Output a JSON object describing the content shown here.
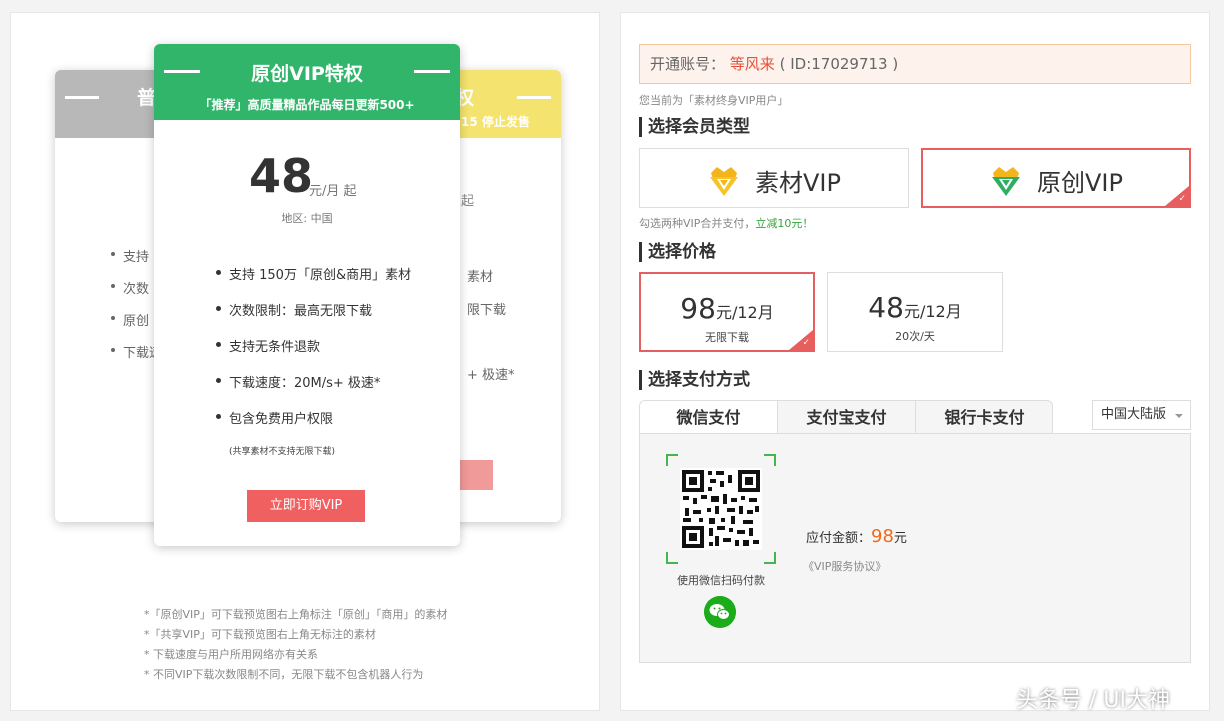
{
  "left": {
    "normal_card": {
      "title": "普",
      "items": [
        "支持",
        "次数",
        "原创",
        "下载速"
      ]
    },
    "shared_card": {
      "title": "权",
      "subtitle": "15 停止发售",
      "per": "起",
      "items": [
        "素材",
        "限下载",
        "+ 极速*"
      ]
    },
    "vip_card": {
      "title": "原创VIP特权",
      "subtitle": "「推荐」高质量精品作品每日更新500+",
      "price": "48",
      "price_unit": "元/月 起",
      "region": "地区: 中国",
      "features": [
        "支持 150万「原创&商用」素材",
        "次数限制：最高无限下载",
        "支持无条件退款",
        "下载速度：20M/s+ 极速*",
        "包含免费用户权限"
      ],
      "feature_note": "(共享素材不支持无限下载)",
      "buy_label": "立即订购VIP"
    },
    "notes": [
      "*「原创VIP」可下载预览图右上角标注「原创」「商用」的素材",
      "*「共享VIP」可下载预览图右上角无标注的素材",
      "* 下载速度与用户所用网络亦有关系",
      "* 不同VIP下载次数限制不同，无限下载不包含机器人行为"
    ]
  },
  "right": {
    "account_label": "开通账号：",
    "account_name": "等风来",
    "account_id": "( ID:17029713 )",
    "current_status": "您当前为「素材终身VIP用户」",
    "section_type": "选择会员类型",
    "type_material": "素材VIP",
    "type_original": "原创VIP",
    "combine_tip": "勾选两种VIP合并支付，",
    "combine_discount": "立减10元！",
    "section_price": "选择价格",
    "price_options": [
      {
        "amount": "98",
        "unit": "元/12月",
        "desc": "无限下载"
      },
      {
        "amount": "48",
        "unit": "元/12月",
        "desc": "20次/天"
      }
    ],
    "section_pay": "选择支付方式",
    "tabs": [
      "微信支付",
      "支付宝支付",
      "银行卡支付"
    ],
    "region_select": "中国大陆版",
    "scan_tip": "使用微信扫码付款",
    "due_label": "应付金额：",
    "due_amount": "98",
    "due_unit": "元",
    "agreement": "《VIP服务协议》"
  },
  "watermark": "头条号 / UI大神",
  "colors": {
    "vip_green": "#31b56a",
    "shared_yellow": "#f4e36f",
    "normal_gray": "#b8b8b8",
    "accent_red": "#e85d5d",
    "buy_red": "#f16060",
    "wechat_green": "#1aad19",
    "amount_orange": "#f06a17"
  }
}
